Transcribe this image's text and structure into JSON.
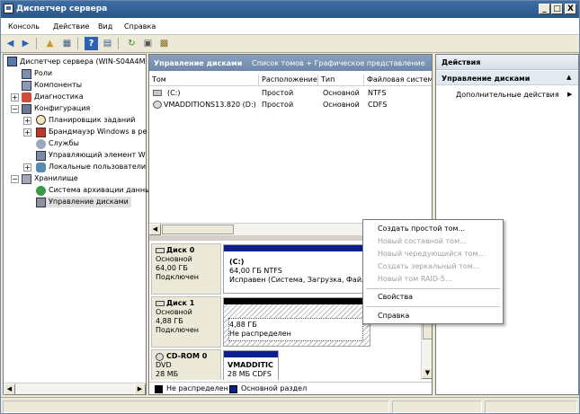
{
  "window": {
    "title": "Диспетчер сервера",
    "buttons": {
      "minimize": "_",
      "maximize": "□",
      "close": "X"
    }
  },
  "menu": [
    "Консоль",
    "Действие",
    "Вид",
    "Справка"
  ],
  "tree": {
    "root": "Диспетчер сервера (WIN-S04A4M",
    "roles": "Роли",
    "components": "Компоненты",
    "diagnostics": "Диагностика",
    "configuration": "Конфигурация",
    "config_items": [
      "Планировщик заданий",
      "Брандмауэр Windows в ре",
      "Службы",
      "Управляющий элемент W",
      "Локальные пользователи"
    ],
    "storage": "Хранилище",
    "storage_items": [
      "Система архивации данны",
      "Управление дисками"
    ]
  },
  "center": {
    "header_title": "Управление дисками",
    "header_subtitle": "Список томов + Графическое представление",
    "columns": [
      "Том",
      "Расположение",
      "Тип",
      "Файловая систем"
    ],
    "rows": [
      {
        "name": "(C:)",
        "layout": "Простой",
        "type": "Основной",
        "fs": "NTFS"
      },
      {
        "name": "VMADDITIONS13.820 (D:)",
        "layout": "Простой",
        "type": "Основной",
        "fs": "CDFS"
      }
    ],
    "disks": [
      {
        "name": "Диск 0",
        "type": "Основной",
        "size": "64,00 ГБ",
        "status": "Подключен",
        "vol_title": "(C:)",
        "vol_size": "64,00 ГБ NTFS",
        "vol_status": "Исправен (Система, Загрузка, Файл п"
      },
      {
        "name": "Диск 1",
        "type": "Основной",
        "size": "4,88 ГБ",
        "status": "Подключен",
        "vol_title": "",
        "vol_size": "4,88 ГБ",
        "vol_status": "Не распределен"
      },
      {
        "name": "CD-ROM 0",
        "type": "DVD",
        "size": "28 МБ",
        "status": "",
        "vol_title": "VMADDITIC",
        "vol_size": "28 МБ CDFS",
        "vol_status": ""
      }
    ],
    "legend": {
      "unallocated": "Не распределен",
      "primary": "Основной раздел"
    }
  },
  "actions": {
    "header": "Действия",
    "section": "Управление дисками",
    "items": [
      "Дополнительные действия"
    ]
  },
  "context_menu": {
    "items": [
      {
        "label": "Создать простой том...",
        "enabled": true
      },
      {
        "label": "Новый составной том...",
        "enabled": false
      },
      {
        "label": "Новый чередующийся том...",
        "enabled": false
      },
      {
        "label": "Создать зеркальный том...",
        "enabled": false
      },
      {
        "label": "Новый том RAID-5...",
        "enabled": false
      },
      {
        "label": "Свойства",
        "enabled": true
      },
      {
        "label": "Справка",
        "enabled": true
      }
    ]
  },
  "colors": {
    "primary_partition": "#0a1e8c",
    "unallocated": "#000000",
    "header_blue": "#6e88aa"
  }
}
